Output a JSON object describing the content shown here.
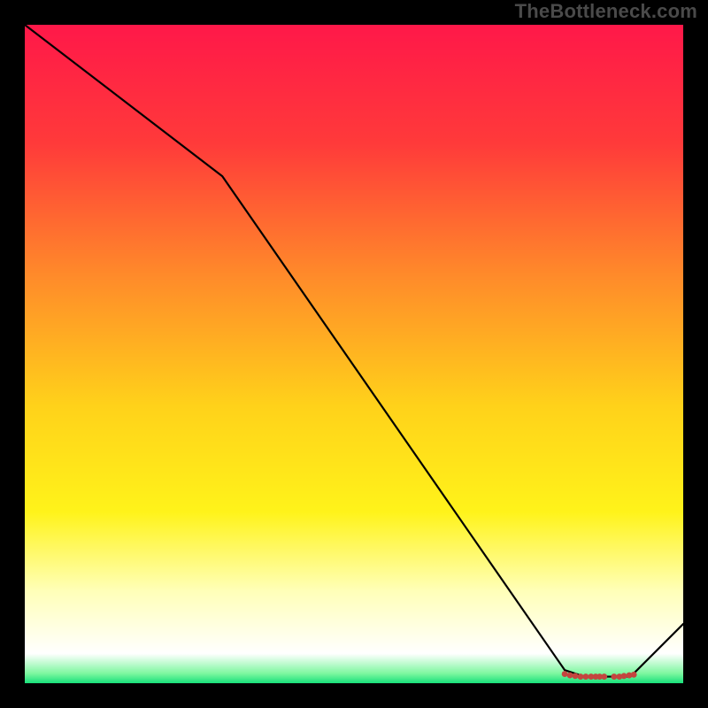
{
  "watermark": "TheBottleneck.com",
  "chart_data": {
    "type": "line",
    "title": "",
    "xlabel": "",
    "ylabel": "",
    "xlim": [
      0,
      100
    ],
    "ylim": [
      0,
      100
    ],
    "grid": false,
    "legend": false,
    "background_gradient_stops": [
      {
        "offset": 0.0,
        "color": "#ff1849"
      },
      {
        "offset": 0.18,
        "color": "#ff3a3a"
      },
      {
        "offset": 0.38,
        "color": "#ff8a2a"
      },
      {
        "offset": 0.58,
        "color": "#ffd21a"
      },
      {
        "offset": 0.74,
        "color": "#fff31a"
      },
      {
        "offset": 0.86,
        "color": "#ffffb8"
      },
      {
        "offset": 0.955,
        "color": "#ffffff"
      },
      {
        "offset": 0.985,
        "color": "#7ef7a0"
      },
      {
        "offset": 1.0,
        "color": "#18e07a"
      }
    ],
    "series": [
      {
        "name": "bottleneck-curve",
        "color": "#000000",
        "x": [
          0,
          30,
          82,
          85,
          92,
          100
        ],
        "y": [
          100,
          77,
          2,
          1,
          1,
          9
        ]
      }
    ],
    "markers": {
      "name": "optimal-range",
      "color": "#c4453f",
      "shape": "circle",
      "x": [
        82.0,
        82.8,
        83.6,
        84.4,
        85.2,
        86.0,
        86.7,
        87.3,
        88.0,
        89.5,
        90.3,
        91.0,
        91.8,
        92.5
      ],
      "y": [
        1.4,
        1.2,
        1.1,
        1.0,
        1.0,
        1.0,
        1.0,
        1.0,
        1.0,
        1.0,
        1.0,
        1.1,
        1.2,
        1.3
      ]
    }
  }
}
